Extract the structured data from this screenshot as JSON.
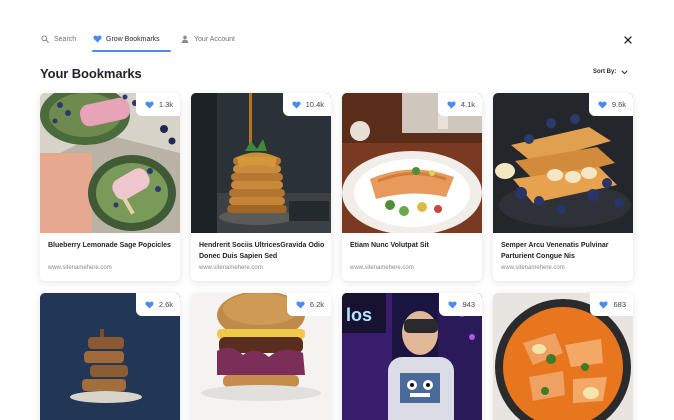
{
  "nav": {
    "search_label": "Search",
    "grow_label": "Grow Bookmarks",
    "account_label": "Your Account",
    "active_tab": "Grow Bookmarks",
    "accent_color": "#4b8bf0"
  },
  "page": {
    "title": "Your Bookmarks",
    "sort_label": "Sort By:"
  },
  "icons": {
    "search": "search-icon",
    "grow": "heart-icon",
    "account": "user-icon",
    "close": "close-icon",
    "sort": "chevron-down-icon",
    "likes": "heart-icon"
  },
  "cards": [
    {
      "likes": "1.3k",
      "title": "Blueberry Lemonade Sage Popcicles",
      "site": "www.sitenamehere.com"
    },
    {
      "likes": "10.4k",
      "title": "Hendrerit Sociis UltricesGravida Odio Donec Duis Sapien Sed",
      "site": "www.sitenamehere.com"
    },
    {
      "likes": "4.1k",
      "title": "Etiam Nunc Volutpat Sit",
      "site": "www.sitenamehere.com"
    },
    {
      "likes": "9.6k",
      "title": "Semper Arcu Venenatis Pulvinar Parturient Congue Nis",
      "site": "www.sitenamehere.com"
    },
    {
      "likes": "2.6k"
    },
    {
      "likes": "6.2k"
    },
    {
      "likes": "943"
    },
    {
      "likes": "683"
    }
  ]
}
